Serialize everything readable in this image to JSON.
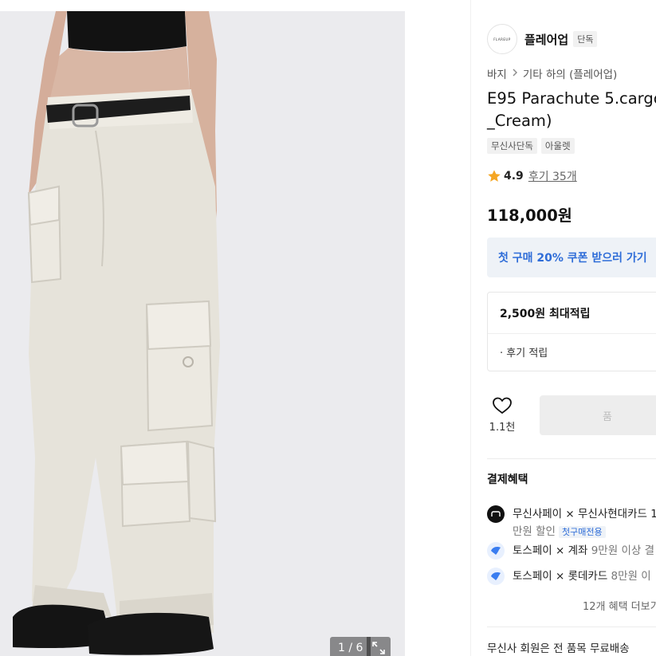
{
  "gallery": {
    "counter": "1 / 6",
    "expand_icon": "expand-arrows-icon"
  },
  "brand": {
    "logo_text": "FLAREUP",
    "name": "플레어업",
    "badge": "단독"
  },
  "breadcrumb": {
    "items": [
      "바지",
      "기타 하의 (플레어업)"
    ],
    "separator_icon": "chevron-right-icon"
  },
  "product": {
    "title": "E95 Parachute 5.cargo\n_Cream)",
    "tags": [
      "무신사단독",
      "아울렛"
    ],
    "rating": "4.9",
    "reviews": "후기 35개",
    "price": "118,000원"
  },
  "coupon": {
    "label": "첫 구매 20% 쿠폰 받으러 가기"
  },
  "points": {
    "max_label": "2,500원 최대적립",
    "sub_label": "· 후기 적립"
  },
  "actions": {
    "like_count": "1.1천",
    "buy_label": "품"
  },
  "benefits": {
    "title": "결제혜택",
    "items": [
      {
        "icon": "musinsa-pay-icon",
        "line1": "무신사페이 × 무신사현대카드 1",
        "line2": "만원 할인",
        "chip": "첫구매전용"
      },
      {
        "icon": "toss-pay-icon",
        "lead": "토스페이 × 계좌 ",
        "rest": "9만원 이상 결"
      },
      {
        "icon": "toss-pay-icon",
        "lead": "토스페이 × 롯데카드 ",
        "rest": "8만원 이"
      }
    ],
    "more": "12개 혜택 더보기"
  },
  "shipping": "무신사 회원은 전 품목 무료배송",
  "colors": {
    "accent_blue": "#2f6dd8",
    "star": "#f5a623",
    "toss": "#3a7df0"
  }
}
